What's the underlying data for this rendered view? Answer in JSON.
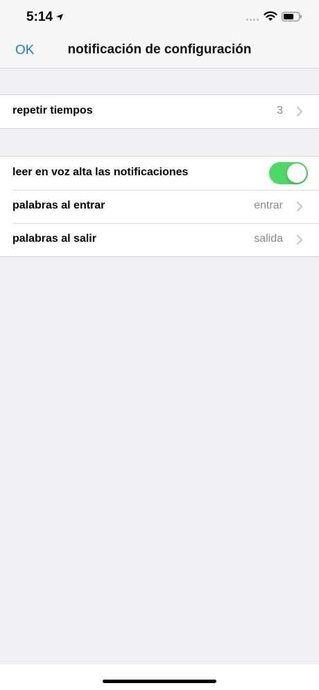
{
  "status_bar": {
    "time": "5:14",
    "icons": [
      "location-arrow-icon",
      "cellular-signal-icon",
      "wifi-icon",
      "battery-icon"
    ]
  },
  "nav": {
    "ok_label": "OK",
    "title": "notificación de configuración"
  },
  "settings": {
    "repeat": {
      "label": "repetir tiempos",
      "value": "3"
    },
    "read_aloud": {
      "label": "leer en voz alta las notificaciones",
      "enabled": true
    },
    "enter_words": {
      "label": "palabras al entrar",
      "value": "entrar"
    },
    "exit_words": {
      "label": "palabras al salir",
      "value": "salida"
    }
  },
  "colors": {
    "accent": "#1a7fd6",
    "toggle_on": "#4cd964",
    "background": "#efeff4",
    "secondary_text": "#8a8a8e"
  }
}
